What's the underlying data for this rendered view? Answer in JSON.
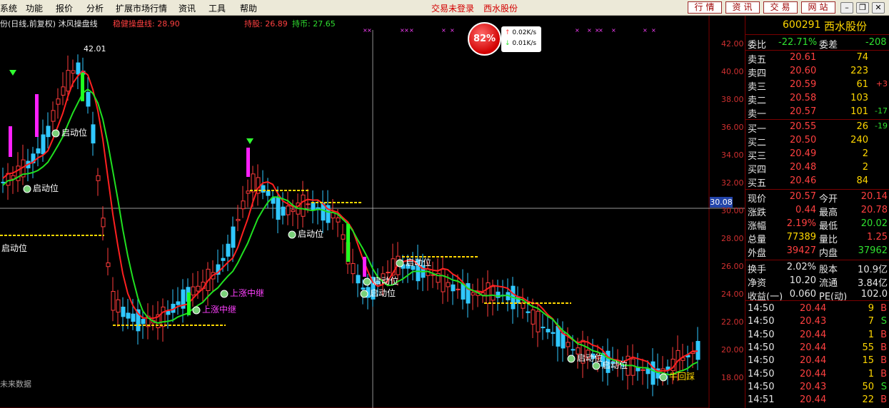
{
  "menu": [
    "系统",
    "功能",
    "报价",
    "分析",
    "扩展市场行情",
    "资讯",
    "工具",
    "帮助"
  ],
  "status": {
    "login": "交易未登录",
    "stock_link": "西水股份"
  },
  "top_buttons": [
    "行情",
    "资讯",
    "交易",
    "网站"
  ],
  "window_buttons": [
    "–",
    "❐",
    "✕"
  ],
  "chart_header": {
    "title": "份(日线,前复权) 沐风操盘线",
    "line1_label": "稳健操盘线: 28.90",
    "hold_label": "持股: 26.89",
    "coin_label": "持币: 27.65"
  },
  "speed": {
    "percent": "82%",
    "up": "0.02K/s",
    "down": "0.01K/s"
  },
  "price_axis": [
    "42.00",
    "40.00",
    "38.00",
    "36.00",
    "34.00",
    "32.00",
    "30.00",
    "28.00",
    "26.00",
    "24.00",
    "22.00",
    "20.00",
    "18.00"
  ],
  "cursor_price": "30.08",
  "chart_annotations": {
    "high_label": "42.01",
    "no_data": "未来数据",
    "signals": [
      {
        "text": "启动位",
        "color": "#ffffff"
      },
      {
        "text": "启动位",
        "color": "#ffffff"
      },
      {
        "text": "启动位",
        "color": "#ffffff"
      },
      {
        "text": "启动位",
        "color": "#ffffff"
      },
      {
        "text": "启动位",
        "color": "#ffffff"
      },
      {
        "text": "启动位",
        "color": "#ffffff"
      },
      {
        "text": "启动位",
        "color": "#ffffff"
      },
      {
        "text": "启动位",
        "color": "#ffffff"
      },
      {
        "text": "启动位",
        "color": "#ffffff"
      },
      {
        "text": "牛回踩",
        "color": "#ffd700"
      },
      {
        "text": "上涨中继",
        "color": "#ff40ff"
      },
      {
        "text": "上涨中继",
        "color": "#ff40ff"
      }
    ]
  },
  "stock": {
    "code": "600291",
    "name": "西水股份"
  },
  "weibi": {
    "label1": "委比",
    "val1": "-22.71%",
    "label2": "委差",
    "val2": "-208"
  },
  "asks": [
    {
      "label": "卖五",
      "price": "20.61",
      "vol": "74",
      "chg": ""
    },
    {
      "label": "卖四",
      "price": "20.60",
      "vol": "223",
      "chg": ""
    },
    {
      "label": "卖三",
      "price": "20.59",
      "vol": "61",
      "chg": "+3"
    },
    {
      "label": "卖二",
      "price": "20.58",
      "vol": "103",
      "chg": ""
    },
    {
      "label": "卖一",
      "price": "20.57",
      "vol": "101",
      "chg": "-17"
    }
  ],
  "bids": [
    {
      "label": "买一",
      "price": "20.55",
      "vol": "26",
      "chg": "-19"
    },
    {
      "label": "买二",
      "price": "20.50",
      "vol": "240",
      "chg": ""
    },
    {
      "label": "买三",
      "price": "20.49",
      "vol": "2",
      "chg": ""
    },
    {
      "label": "买四",
      "price": "20.48",
      "vol": "2",
      "chg": ""
    },
    {
      "label": "买五",
      "price": "20.46",
      "vol": "84",
      "chg": ""
    }
  ],
  "quote": [
    {
      "l1": "现价",
      "v1": "20.57",
      "l2": "今开",
      "v2": "20.14"
    },
    {
      "l1": "涨跌",
      "v1": "0.44",
      "l2": "最高",
      "v2": "20.78"
    },
    {
      "l1": "涨幅",
      "v1": "2.19%",
      "l2": "最低",
      "v2": "20.02"
    },
    {
      "l1": "总量",
      "v1": "77389",
      "l2": "量比",
      "v2": "1.25"
    },
    {
      "l1": "外盘",
      "v1": "39427",
      "l2": "内盘",
      "v2": "37962"
    }
  ],
  "fund": [
    {
      "l1": "换手",
      "v1": "2.02%",
      "l2": "股本",
      "v2": "10.9亿"
    },
    {
      "l1": "净资",
      "v1": "10.20",
      "l2": "流通",
      "v2": "3.84亿"
    },
    {
      "l1": "收益(一)",
      "v1": "0.060",
      "l2": "PE(动)",
      "v2": "102.0"
    }
  ],
  "ticks": [
    {
      "time": "14:50",
      "price": "20.44",
      "vol": "9",
      "side": "B"
    },
    {
      "time": "14:50",
      "price": "20.43",
      "vol": "7",
      "side": "S"
    },
    {
      "time": "14:50",
      "price": "20.44",
      "vol": "1",
      "side": "B"
    },
    {
      "time": "14:50",
      "price": "20.44",
      "vol": "55",
      "side": "B"
    },
    {
      "time": "14:50",
      "price": "20.44",
      "vol": "15",
      "side": "B"
    },
    {
      "time": "14:50",
      "price": "20.44",
      "vol": "1",
      "side": "B"
    },
    {
      "time": "14:50",
      "price": "20.43",
      "vol": "50",
      "side": "S"
    },
    {
      "time": "14:51",
      "price": "20.44",
      "vol": "22",
      "side": "B"
    }
  ],
  "colors": {
    "red": "#ff4040",
    "green": "#30e030",
    "yellow": "#ffd700",
    "magenta": "#ff40ff",
    "cyan": "#30d0d0"
  }
}
